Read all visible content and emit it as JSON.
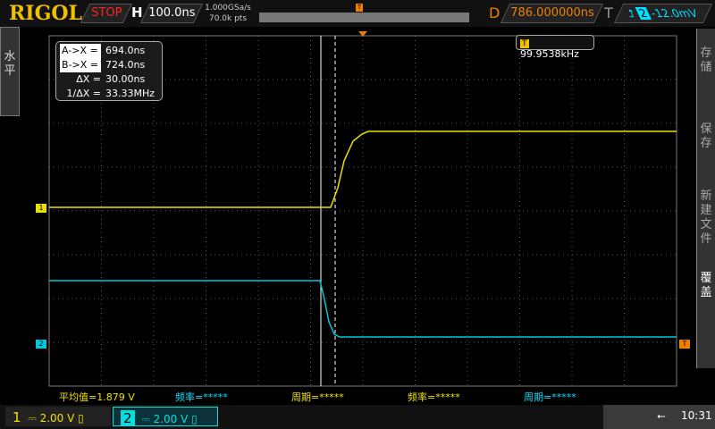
{
  "header": {
    "logo": "RIGOL",
    "run_state": "STOP",
    "h_label": "H",
    "timebase": "100.0ns",
    "sample_rate": "1.000GSa/s",
    "memory_depth": "70.0k pts",
    "delay_label": "D",
    "delay": "786.000000ns",
    "trigger_label": "T",
    "trigger_source": "2",
    "trigger_level": "-12.0mV"
  },
  "left_menu": {
    "label": "水平"
  },
  "right_menu": {
    "items": [
      "存储",
      "保存",
      "新建文件",
      "覆盖"
    ]
  },
  "cursor_panel": {
    "rows": [
      {
        "label": "A->X =",
        "value": "694.0ns"
      },
      {
        "label": "B->X =",
        "value": "724.0ns"
      },
      {
        "label": "ΔX =",
        "value": "30.00ns"
      },
      {
        "label": "1/ΔX =",
        "value": "33.33MHz"
      }
    ]
  },
  "frequency_counter": {
    "icon": "T",
    "value": "99.9538kHz"
  },
  "measurements": [
    {
      "text": "平均值=1.879 V",
      "color": "#f0e000"
    },
    {
      "text": "频率=*****",
      "color": "#00e0ff"
    },
    {
      "text": "周期=*****",
      "color": "#f0e000"
    },
    {
      "text": "频率=*****",
      "color": "#f0e000"
    },
    {
      "text": "周期=*****",
      "color": "#00e0ff"
    }
  ],
  "channels": [
    {
      "num": "1",
      "coupling": "⎓",
      "scale": "2.00 V",
      "color": "#f0e000"
    },
    {
      "num": "2",
      "coupling": "⎓",
      "scale": "2.00 V",
      "color": "#00e0e0"
    }
  ],
  "status": {
    "time": "10:31"
  },
  "markers": {
    "ch1": "1",
    "ch2": "2",
    "trigger": "T"
  }
}
